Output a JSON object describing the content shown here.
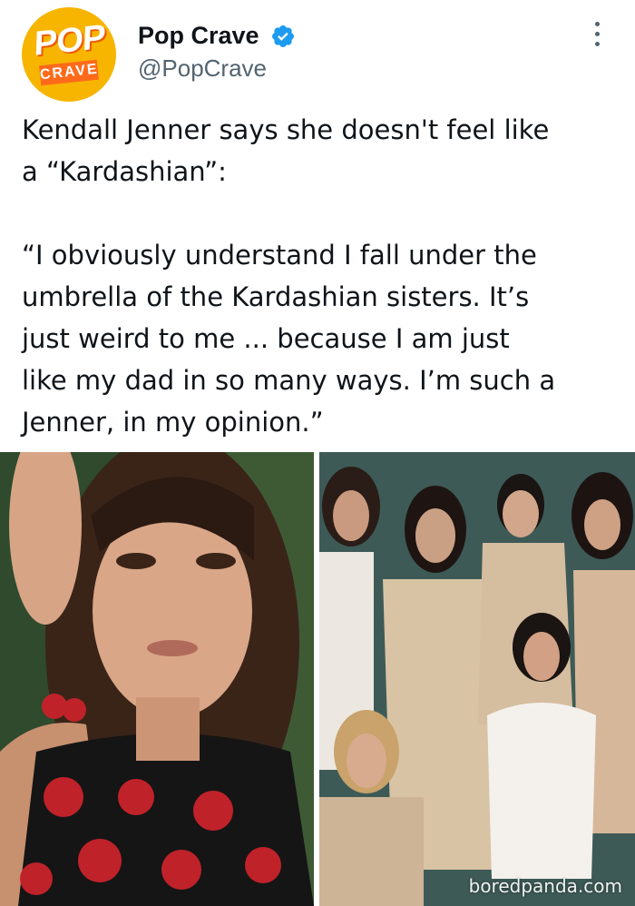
{
  "account": {
    "name": "Pop Crave",
    "handle": "@PopCrave",
    "verified": true,
    "avatar_logo": {
      "line1": "POP",
      "line2": "CRAVE"
    },
    "icons": {
      "verified": "verified-badge-icon",
      "more": "more-vertical-icon"
    }
  },
  "tweet": {
    "paragraph1": "Kendall Jenner says she doesn't feel like\na “Kardashian”:",
    "paragraph2": "“I obviously understand I fall under the\numbrella of the Kardashian sisters. It’s\njust weird to me ... because I am just\nlike my dad in so many ways. I’m such a\nJenner, in my opinion.”"
  },
  "media": {
    "left_photo": "portrait of woman with cherry earrings and cherry-print top",
    "right_photo": "group portrait of six women in cream and white outfits"
  },
  "watermark": "boredpanda.com",
  "colors": {
    "verified": "#1d9bf0",
    "handle": "#536471",
    "avatar_bg": "#f7b500",
    "avatar_accent": "#ff6a1a"
  }
}
